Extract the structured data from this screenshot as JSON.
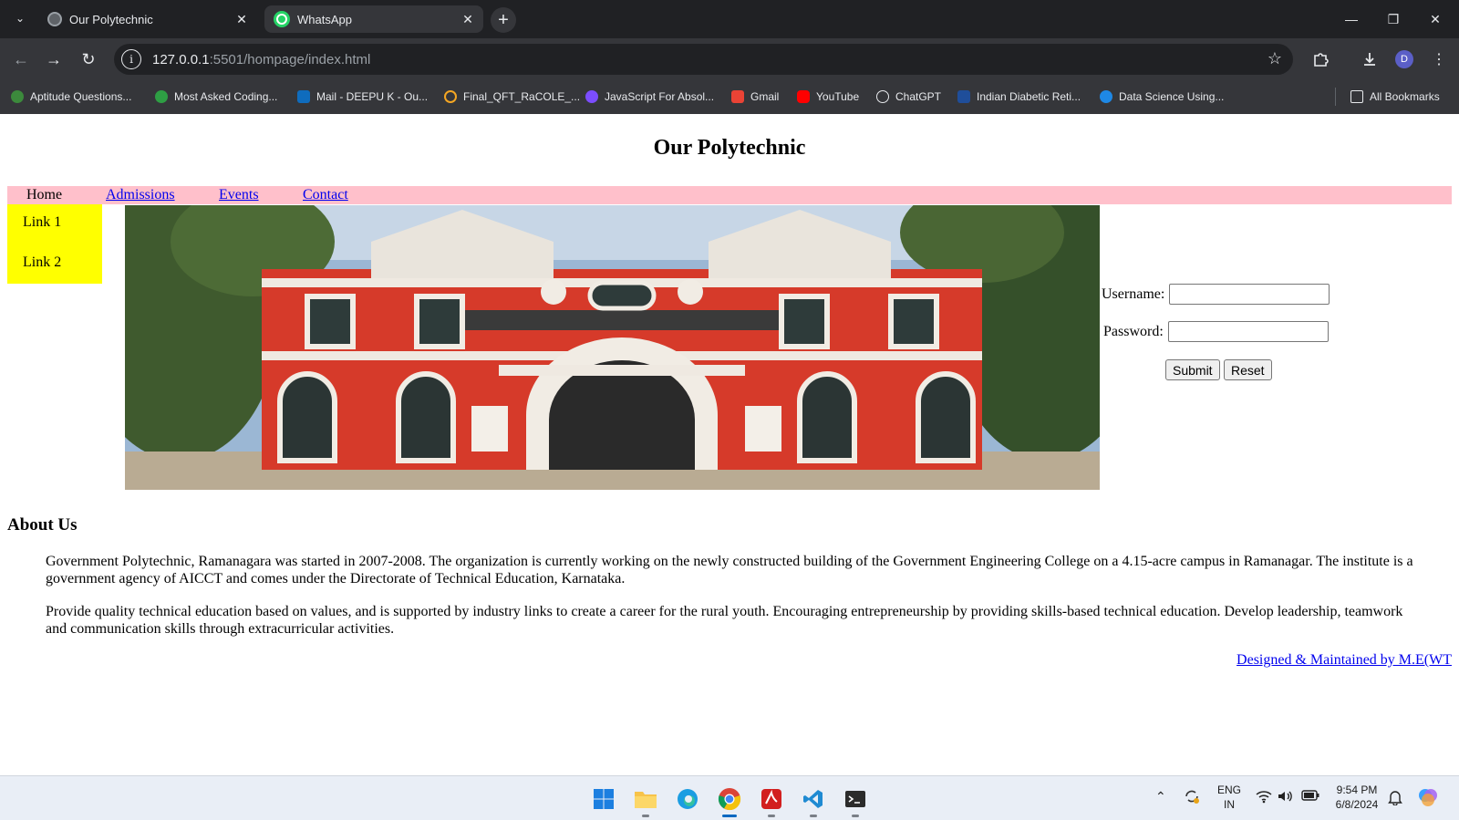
{
  "browser": {
    "tabs": [
      {
        "title": "Our Polytechnic",
        "active": false
      },
      {
        "title": "WhatsApp",
        "active": true
      }
    ],
    "url_host": "127.0.0.1",
    "url_rest": ":5501/hompage/index.html",
    "bookmarks": [
      "Aptitude Questions...",
      "Most Asked Coding...",
      "Mail - DEEPU K - Ou...",
      "Final_QFT_RaCOLE_...",
      "JavaScript For Absol...",
      "Gmail",
      "YouTube",
      "ChatGPT",
      "Indian Diabetic Reti...",
      "Data Science Using..."
    ],
    "all_bookmarks": "All Bookmarks",
    "profile_initial": "D"
  },
  "page": {
    "title": "Our Polytechnic",
    "nav": {
      "home": "Home",
      "admissions": "Admissions",
      "events": "Events",
      "contact": "Contact"
    },
    "sidebar": {
      "link1": "Link 1",
      "link2": "Link 2"
    },
    "login": {
      "username_label": "Username:",
      "password_label": "Password:",
      "submit": "Submit",
      "reset": "Reset"
    },
    "about": {
      "heading": "About Us",
      "p1": "Government Polytechnic, Ramanagara was started in 2007-2008. The organization is currently working on the newly constructed building of the Government Engineering College on a 4.15-acre campus in Ramanagar. The institute is a government agency of AICCT and comes under the Directorate of Technical Education, Karnataka.",
      "p2": "Provide quality technical education based on values, and is supported by industry links to create a career for the rural youth. Encouraging entrepreneurship by providing skills-based technical education. Develop leadership, teamwork and communication skills through extracurricular activities."
    },
    "footer_credit": "Designed & Maintained by M.E(WT"
  },
  "taskbar": {
    "lang_top": "ENG",
    "lang_bottom": "IN",
    "time": "9:54 PM",
    "date": "6/8/2024"
  },
  "colors": {
    "nav_bar": "#ffc0cb",
    "sidebar": "#ffff00",
    "link": "#0000ee",
    "building_red": "#d63a2a"
  }
}
